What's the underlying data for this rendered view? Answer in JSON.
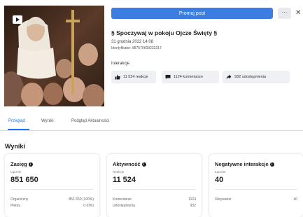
{
  "header": {
    "promote_label": "Promuj post",
    "more_label": "···",
    "close_label": "✕"
  },
  "post": {
    "title": "§ Spoczywaj w pokoju Ojcze Święty §",
    "date": "31 grudnia 2022 14:08",
    "identifier": "Identyfikator: 887570609232317",
    "interactions_label": "Interakcje",
    "reactions": "11 524 reakcje",
    "comments": "1124 komentarze",
    "shares": "932 udostępnienia"
  },
  "tabs": [
    {
      "label": "Przegląd",
      "active": true
    },
    {
      "label": "Wyniki",
      "active": false
    },
    {
      "label": "Podgląd Aktualności",
      "active": false
    }
  ],
  "results": {
    "title": "Wyniki",
    "cards": [
      {
        "title": "Zasięg",
        "sub": "Łącznie",
        "value": "851 650",
        "rows": [
          {
            "label": "Organiczny",
            "value": "851 650 (100%)"
          },
          {
            "label": "Płatny",
            "value": "0 (0%)"
          }
        ]
      },
      {
        "title": "Aktywność",
        "sub": "Reakcje",
        "value": "11 524",
        "rows": [
          {
            "label": "Komentarze",
            "value": "1124"
          },
          {
            "label": "Udostępnienia",
            "value": "932"
          }
        ]
      },
      {
        "title": "Negatywne interakcje",
        "sub": "Łącznie",
        "value": "40",
        "rows": [
          {
            "label": "Ukrywanie",
            "value": "40"
          }
        ]
      }
    ]
  },
  "colors": {
    "accent": "#1877f2",
    "promote": "#3b7de0"
  }
}
